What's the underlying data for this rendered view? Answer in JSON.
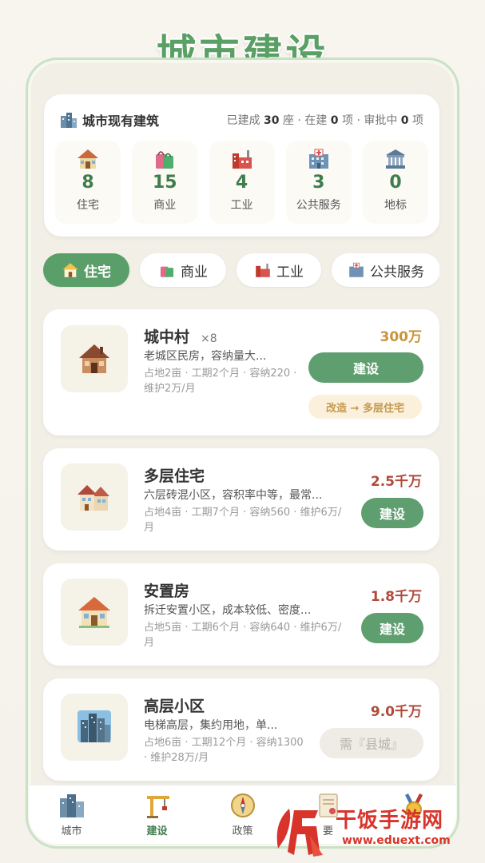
{
  "page": {
    "title": "城市建设"
  },
  "summary": {
    "title": "城市现有建筑",
    "built_label": "已建成",
    "built_count": "30",
    "built_unit": "座",
    "building_label": "在建",
    "building_count": "0",
    "building_unit": "项",
    "pending_label": "审批中",
    "pending_count": "0",
    "pending_unit": "项",
    "separator": "·",
    "categories": [
      {
        "icon": "house-icon",
        "count": "8",
        "label": "住宅"
      },
      {
        "icon": "shopping-bag-icon",
        "count": "15",
        "label": "商业"
      },
      {
        "icon": "factory-icon",
        "count": "4",
        "label": "工业"
      },
      {
        "icon": "hospital-icon",
        "count": "3",
        "label": "公共服务"
      },
      {
        "icon": "landmark-icon",
        "count": "0",
        "label": "地标"
      }
    ]
  },
  "tabs": [
    {
      "label": "住宅",
      "icon": "house-icon",
      "active": true
    },
    {
      "label": "商业",
      "icon": "shopping-bag-icon",
      "active": false
    },
    {
      "label": "工业",
      "icon": "factory-icon",
      "active": false
    },
    {
      "label": "公共服务",
      "icon": "hospital-icon",
      "active": false
    }
  ],
  "buildings": [
    {
      "name": "城中村",
      "count": "×8",
      "desc": "老城区民房，容纳量大...",
      "meta": "占地2亩 · 工期2个月 · 容纳220 · 维护2万/月",
      "price": "300万",
      "action": "建设",
      "upgrade": "改造 → 多层住宅"
    },
    {
      "name": "多层住宅",
      "desc": "六层砖混小区，容积率中等，最常...",
      "meta": "占地4亩 · 工期7个月 · 容纳560 · 维护6万/月",
      "price": "2.5千万",
      "action": "建设"
    },
    {
      "name": "安置房",
      "desc": "拆迁安置小区，成本较低、密度...",
      "meta": "占地5亩 · 工期6个月 · 容纳640 · 维护6万/月",
      "price": "1.8千万",
      "action": "建设"
    },
    {
      "name": "高层小区",
      "desc": "电梯高层，集约用地，单...",
      "meta": "占地6亩 · 工期12个月 · 容纳1300 · 维护28万/月",
      "price": "9.0千万",
      "action": "需『县城』"
    }
  ],
  "nav": [
    {
      "label": "城市",
      "icon": "city-icon"
    },
    {
      "label": "建设",
      "icon": "crane-icon",
      "active": true
    },
    {
      "label": "政策",
      "icon": "compass-icon"
    },
    {
      "label": "要",
      "icon": "document-icon"
    },
    {
      "label": "",
      "icon": "medal-icon"
    }
  ],
  "watermark": {
    "text": "干饭手游网",
    "url": "www.eduext.com"
  },
  "colors": {
    "accent": "#5a9f6a",
    "price_gold": "#c9953c",
    "price_red": "#b24a3a",
    "watermark": "#d8342b"
  }
}
